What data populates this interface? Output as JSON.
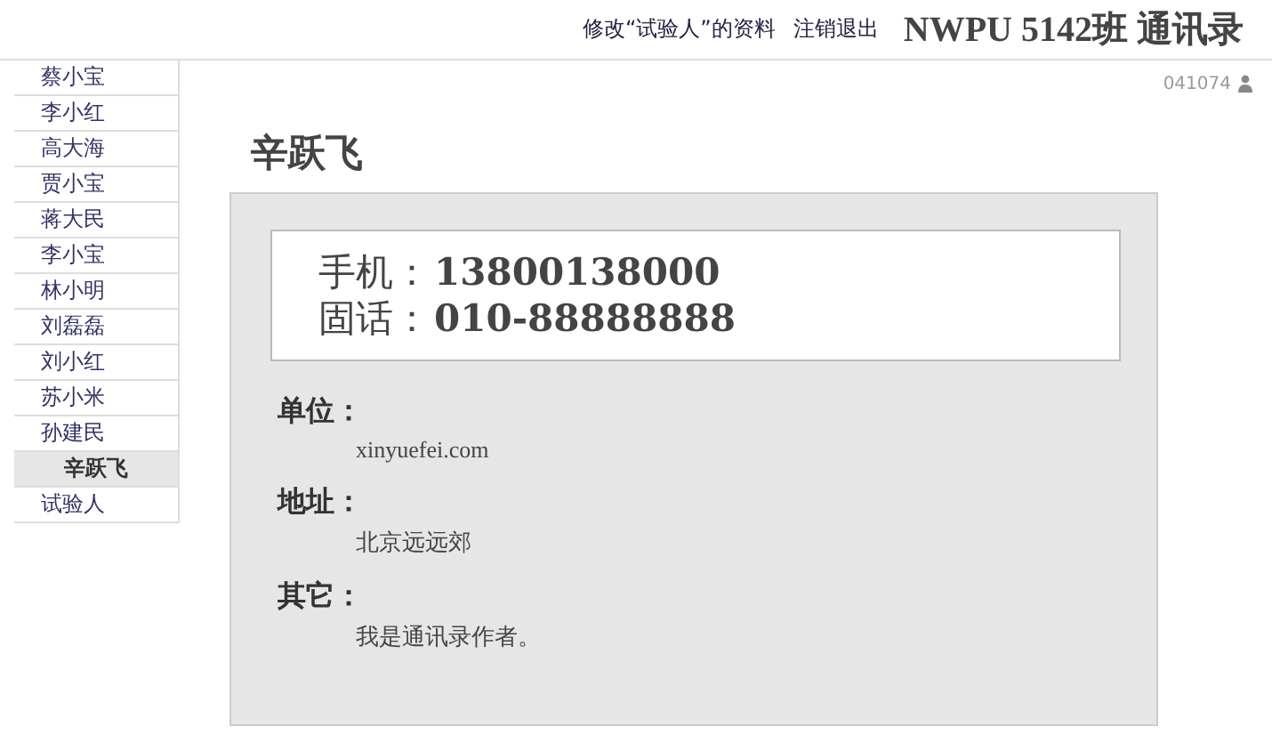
{
  "header": {
    "links": [
      "修改“试验人”的资料",
      "注销退出"
    ],
    "title": "NWPU 5142班 通讯录"
  },
  "sidebar": {
    "items": [
      {
        "label": "蔡小宝",
        "selected": false
      },
      {
        "label": "李小红",
        "selected": false
      },
      {
        "label": "高大海",
        "selected": false
      },
      {
        "label": "贾小宝",
        "selected": false
      },
      {
        "label": "蒋大民",
        "selected": false
      },
      {
        "label": "李小宝",
        "selected": false
      },
      {
        "label": "林小明",
        "selected": false
      },
      {
        "label": "刘磊磊",
        "selected": false
      },
      {
        "label": "刘小红",
        "selected": false
      },
      {
        "label": "苏小米",
        "selected": false
      },
      {
        "label": "孙建民",
        "selected": false
      },
      {
        "label": "辛跃飞",
        "selected": true
      },
      {
        "label": "试验人",
        "selected": false
      }
    ]
  },
  "user_id": "041074",
  "contact": {
    "name": "辛跃飞",
    "phones": [
      {
        "label": "手机：",
        "value": "13800138000"
      },
      {
        "label": "固话：",
        "value": "010-88888888"
      }
    ],
    "fields": [
      {
        "label": "单位：",
        "value": "xinyuefei.com"
      },
      {
        "label": "地址：",
        "value": "北京远远郊"
      },
      {
        "label": "其它：",
        "value": "我是通讯录作者。"
      }
    ]
  }
}
